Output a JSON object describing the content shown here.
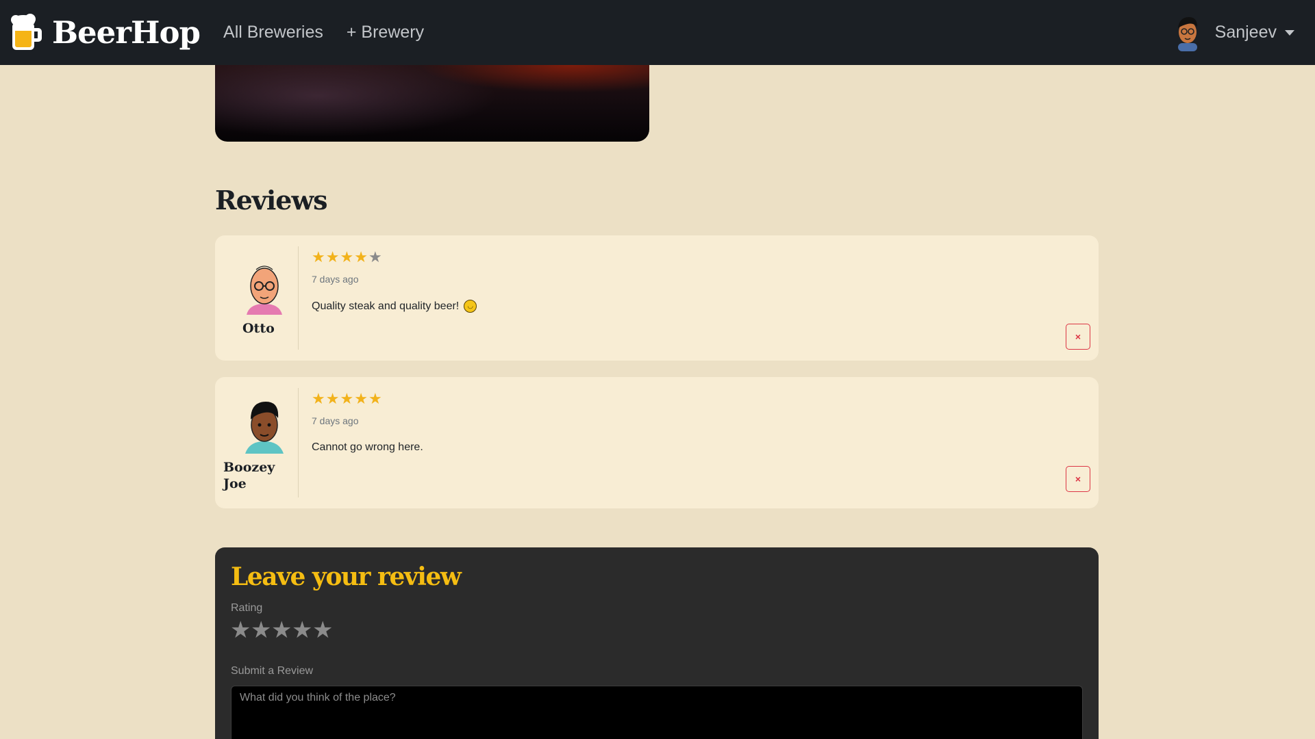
{
  "navbar": {
    "brand": "BeerHop",
    "links": [
      "All Breweries",
      "+ Brewery"
    ],
    "user_name": "Sanjeev"
  },
  "reviews": {
    "heading": "Reviews",
    "items": [
      {
        "author": "Otto",
        "rating": 4,
        "time": "7 days ago",
        "text": "Quality steak and quality beer!",
        "emoji_icon": "wink-emoji",
        "delete_label": "×"
      },
      {
        "author": "Boozey Joe",
        "rating": 5,
        "time": "7 days ago",
        "text": "Cannot go wrong here.",
        "delete_label": "×"
      }
    ]
  },
  "leave_review": {
    "heading": "Leave your review",
    "rating_label": "Rating",
    "rating_value": 0,
    "rating_max": 5,
    "submit_label": "Submit a Review",
    "placeholder": "What did you think of the place?"
  },
  "colors": {
    "page_bg": "#ece0c5",
    "navbar_bg": "#1b1f24",
    "card_bg": "#f8edd4",
    "star_on": "#f2b21b",
    "accent_yellow": "#f5bd12",
    "danger": "#dc3545",
    "dark_card": "#2b2b2b"
  },
  "icons": [
    "beer-mug-icon",
    "user-avatar-icon",
    "caret-down-icon",
    "star-icon",
    "wink-emoji-icon",
    "close-icon"
  ]
}
